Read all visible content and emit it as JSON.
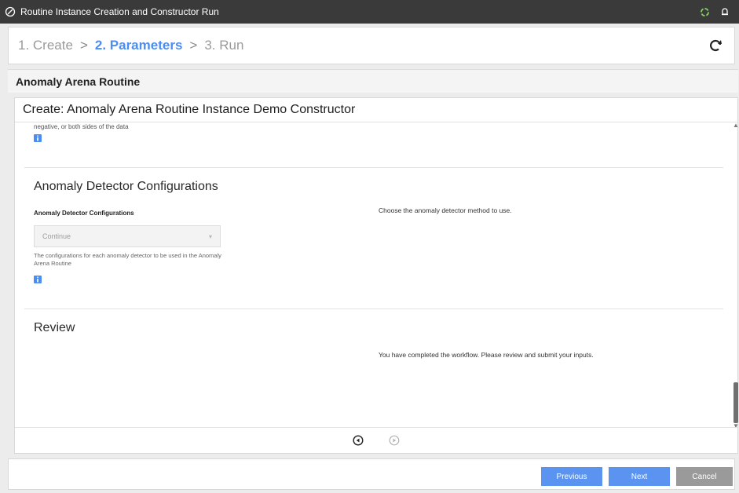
{
  "window": {
    "title": "Routine Instance Creation and Constructor Run"
  },
  "wizard": {
    "steps": [
      "1. Create",
      "2. Parameters",
      "3. Run"
    ],
    "active_step": 1,
    "separator": ">"
  },
  "routine": {
    "title": "Anomaly Arena Routine"
  },
  "panel": {
    "header": "Create: Anomaly Arena Routine Instance Demo Constructor",
    "cut_text": "negative, or both sides of the data",
    "sections": {
      "detector": {
        "title": "Anomaly Detector Configurations",
        "field_label": "Anomaly Detector Configurations",
        "select_value": "Continue",
        "helper_text": "The configurations for each anomaly detector to be used in the Anomaly Arena Routine",
        "description": "Choose the anomaly detector method to use."
      },
      "review": {
        "title": "Review",
        "description": "You have completed the workflow. Please review and submit your inputs."
      }
    }
  },
  "footer": {
    "previous_label": "Previous",
    "next_label": "Next",
    "cancel_label": "Cancel"
  },
  "colors": {
    "accent": "#4b8df0",
    "titlebar": "#3a3a3a",
    "button_primary": "#5b93f0",
    "button_cancel": "#9a9a9a"
  },
  "icons": [
    "app-icon",
    "sync-icon",
    "notification-icon",
    "refresh-icon",
    "info-icon",
    "chevron-down-icon",
    "prev-page-icon",
    "next-page-icon"
  ]
}
